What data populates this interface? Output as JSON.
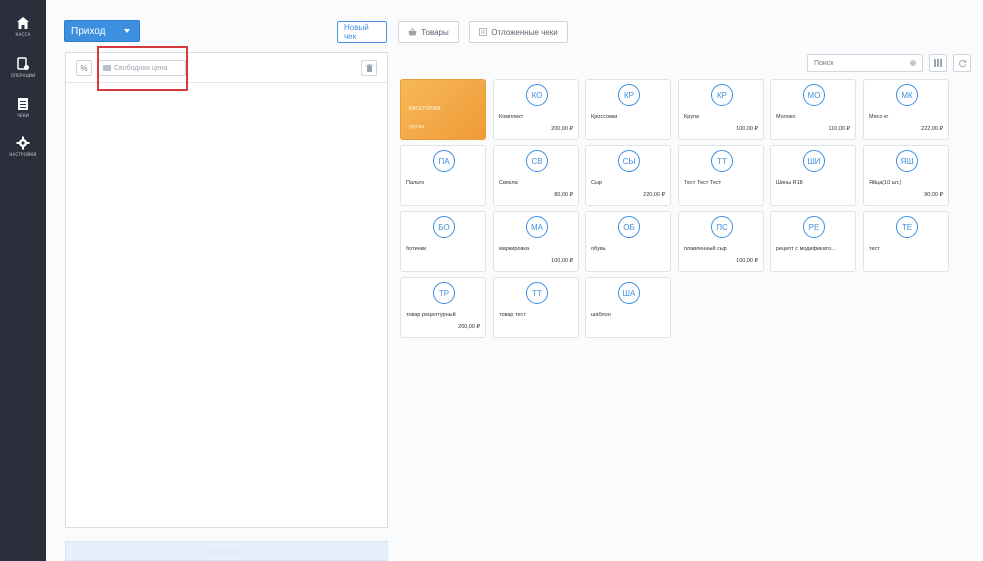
{
  "sidebar": {
    "items": [
      {
        "label": "КАССА",
        "icon": "home-icon"
      },
      {
        "label": "ОПЕРАЦИИ",
        "icon": "operations-icon"
      },
      {
        "label": "ЧЕКИ",
        "icon": "receipt-icon"
      },
      {
        "label": "НАСТРОЙКИ",
        "icon": "gear-icon"
      }
    ]
  },
  "toolbar": {
    "doc_type": "Приход",
    "new_check": "Новый чек",
    "goods": "Товары",
    "held_checks": "Отложенные чеки"
  },
  "left_panel": {
    "discount_symbol": "%",
    "free_price": "Свободная цена",
    "pay_button": "Оплатить"
  },
  "search": {
    "placeholder": "Поиск"
  },
  "category_tile": {
    "label": "КАТЕГОРИЯ",
    "name": "группа"
  },
  "products": [
    {
      "badge": "КО",
      "name": "Комплект",
      "price": "200,00 ₽"
    },
    {
      "badge": "КР",
      "name": "Кроссовки",
      "price": ""
    },
    {
      "badge": "КР",
      "name": "Крупа",
      "price": "100,00 ₽"
    },
    {
      "badge": "МО",
      "name": "Молоко",
      "price": "110,00 ₽"
    },
    {
      "badge": "МК",
      "name": "Мясо кг",
      "price": "222,00 ₽"
    },
    {
      "badge": "ПА",
      "name": "Пальто",
      "price": ""
    },
    {
      "badge": "СВ",
      "name": "Свекла",
      "price": "80,00 ₽"
    },
    {
      "badge": "СЫ",
      "name": "Сыр",
      "price": "220,00 ₽"
    },
    {
      "badge": "ТТ",
      "name": "Тест Тест Тест",
      "price": ""
    },
    {
      "badge": "ШИ",
      "name": "Шины R18",
      "price": ""
    },
    {
      "badge": "ЯШ",
      "name": "Яйца(10 шт.)",
      "price": "90,00 ₽"
    },
    {
      "badge": "БО",
      "name": "ботинки",
      "price": ""
    },
    {
      "badge": "МА",
      "name": "маркировка",
      "price": "100,00 ₽"
    },
    {
      "badge": "ОБ",
      "name": "обувь",
      "price": ""
    },
    {
      "badge": "ПС",
      "name": "плавленный сыр",
      "price": "100,00 ₽"
    },
    {
      "badge": "РЕ",
      "name": "рецепт с модификато...",
      "price": ""
    },
    {
      "badge": "ТЕ",
      "name": "тест",
      "price": ""
    },
    {
      "badge": "ТР",
      "name": "товар рецептурный",
      "price": "200,00 ₽"
    },
    {
      "badge": "ТТ",
      "name": "товар тест",
      "price": ""
    },
    {
      "badge": "ША",
      "name": "шаблон",
      "price": ""
    }
  ]
}
